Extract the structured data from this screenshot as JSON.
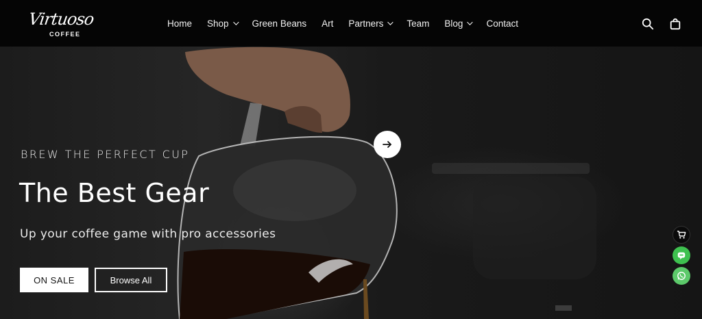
{
  "brand": {
    "logo_script": "Virtuoso",
    "logo_sub": "COFFEE"
  },
  "nav": {
    "items": [
      {
        "label": "Home",
        "dropdown": false
      },
      {
        "label": "Shop",
        "dropdown": true
      },
      {
        "label": "Green Beans",
        "dropdown": false
      },
      {
        "label": "Art",
        "dropdown": false
      },
      {
        "label": "Partners",
        "dropdown": true
      },
      {
        "label": "Team",
        "dropdown": false
      },
      {
        "label": "Blog",
        "dropdown": true
      },
      {
        "label": "Contact",
        "dropdown": false
      }
    ],
    "icons": [
      "search-icon",
      "bag-icon"
    ]
  },
  "hero": {
    "eyebrow": "BREW THE PERFECT CUP",
    "headline": "The Best Gear",
    "subline": "Up your coffee game with pro accessories",
    "primary_button": "ON SALE",
    "secondary_button": "Browse All"
  },
  "floating_widgets": [
    "cart-icon",
    "line-icon",
    "whatsapp-icon"
  ],
  "colors": {
    "header_bg": "#050505",
    "line_green": "#3ec14f",
    "whatsapp_green": "#5cc96a"
  }
}
